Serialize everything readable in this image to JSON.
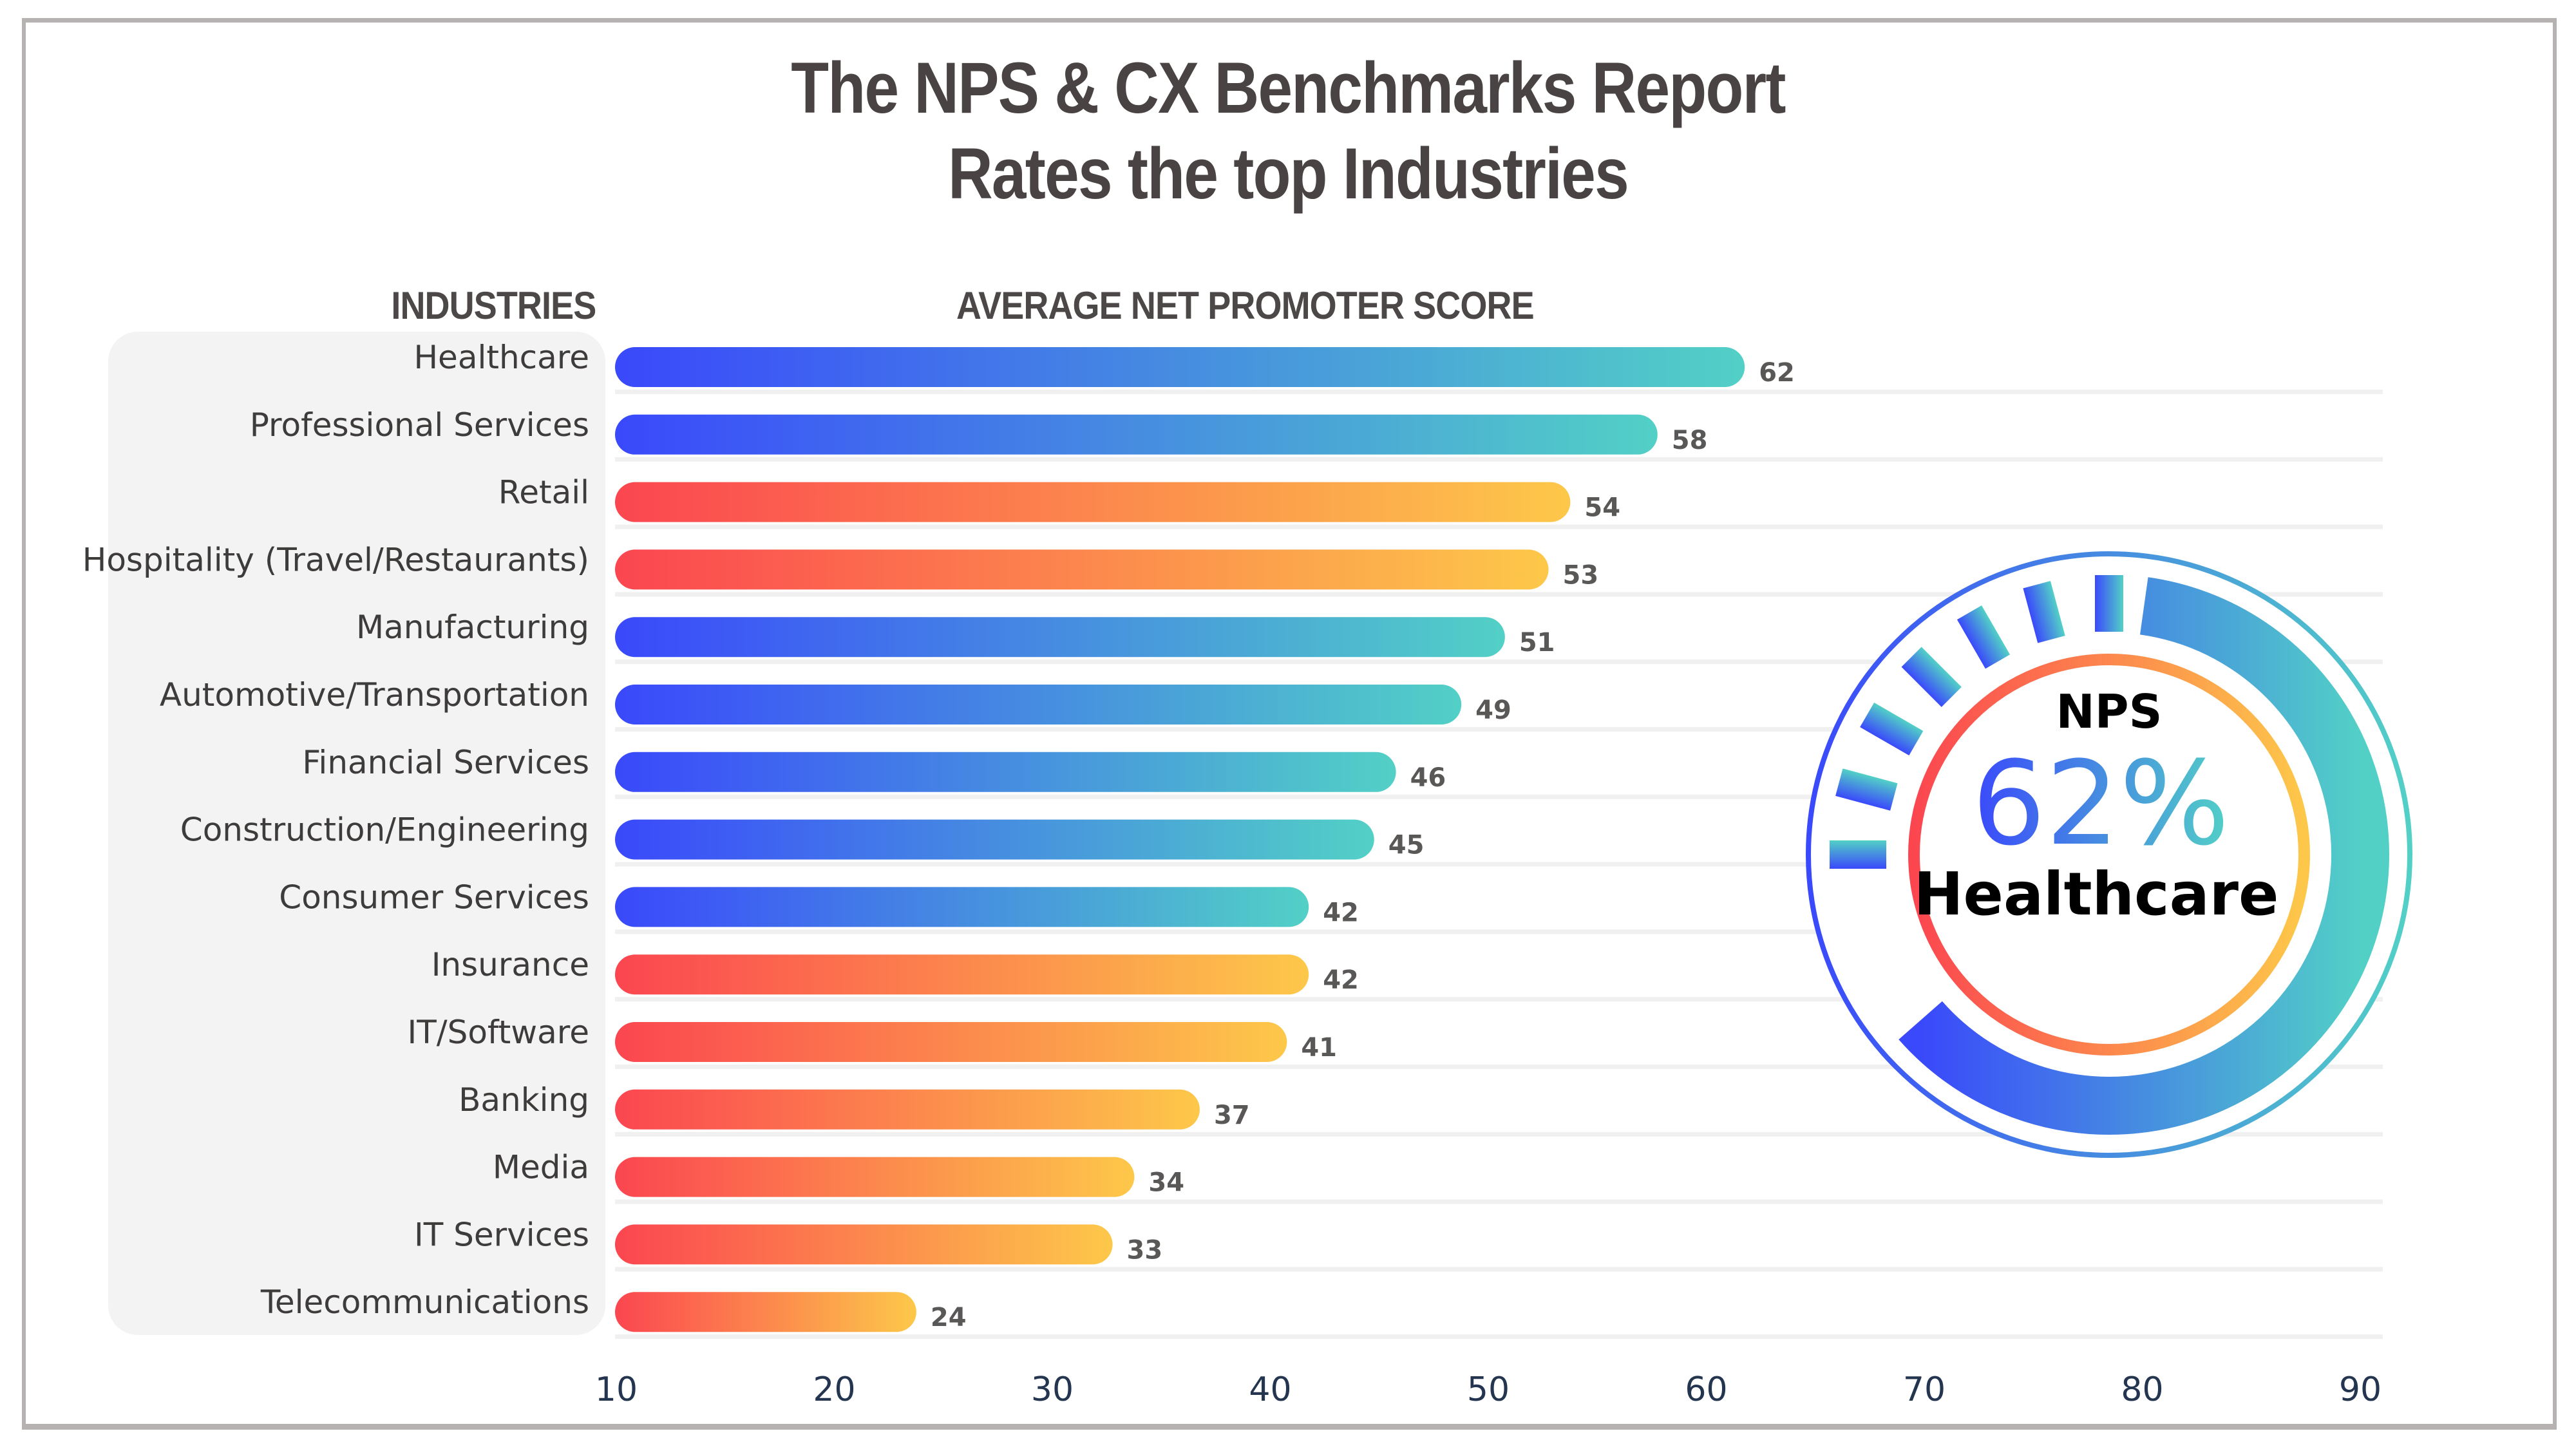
{
  "title_line1": "The NPS & CX Benchmarks Report",
  "title_line2": "Rates the top Industries",
  "headers": {
    "industries": "INDUSTRIES",
    "score": "AVERAGE NET PROMOTER SCORE"
  },
  "colors": {
    "blue_start": "#3a49fb",
    "blue_end": "#52d0c6",
    "red_start": "#fb4650",
    "red_end": "#fdc84a",
    "title": "#4a4343",
    "panel": "#f3f3f3",
    "gridline": "#f0f0f0"
  },
  "badge": {
    "top_text": "NPS",
    "value_text": "62%",
    "bottom_text": "Healthcare",
    "value_fraction": 0.62
  },
  "chart_data": {
    "type": "bar",
    "orientation": "horizontal",
    "title": "The NPS & CX Benchmarks Report Rates the top Industries",
    "xlabel": "AVERAGE NET PROMOTER SCORE",
    "ylabel": "INDUSTRIES",
    "xlim": [
      10,
      90
    ],
    "xticks": [
      10,
      20,
      30,
      40,
      50,
      60,
      70,
      80,
      90
    ],
    "grid": "horizontal row separators",
    "categories": [
      "Healthcare",
      "Professional Services",
      "Retail",
      "Hospitality (Travel/Restaurants)",
      "Manufacturing",
      "Automotive/Transportation",
      "Financial Services",
      "Construction/Engineering",
      "Consumer Services",
      "Insurance",
      "IT/Software",
      "Banking",
      "Media",
      "IT Services",
      "Telecommunications"
    ],
    "values": [
      62,
      58,
      54,
      53,
      51,
      49,
      46,
      45,
      42,
      42,
      41,
      37,
      34,
      33,
      24
    ],
    "color_group": [
      "blue",
      "blue",
      "red",
      "red",
      "blue",
      "blue",
      "blue",
      "blue",
      "blue",
      "red",
      "red",
      "red",
      "red",
      "red",
      "red"
    ]
  }
}
